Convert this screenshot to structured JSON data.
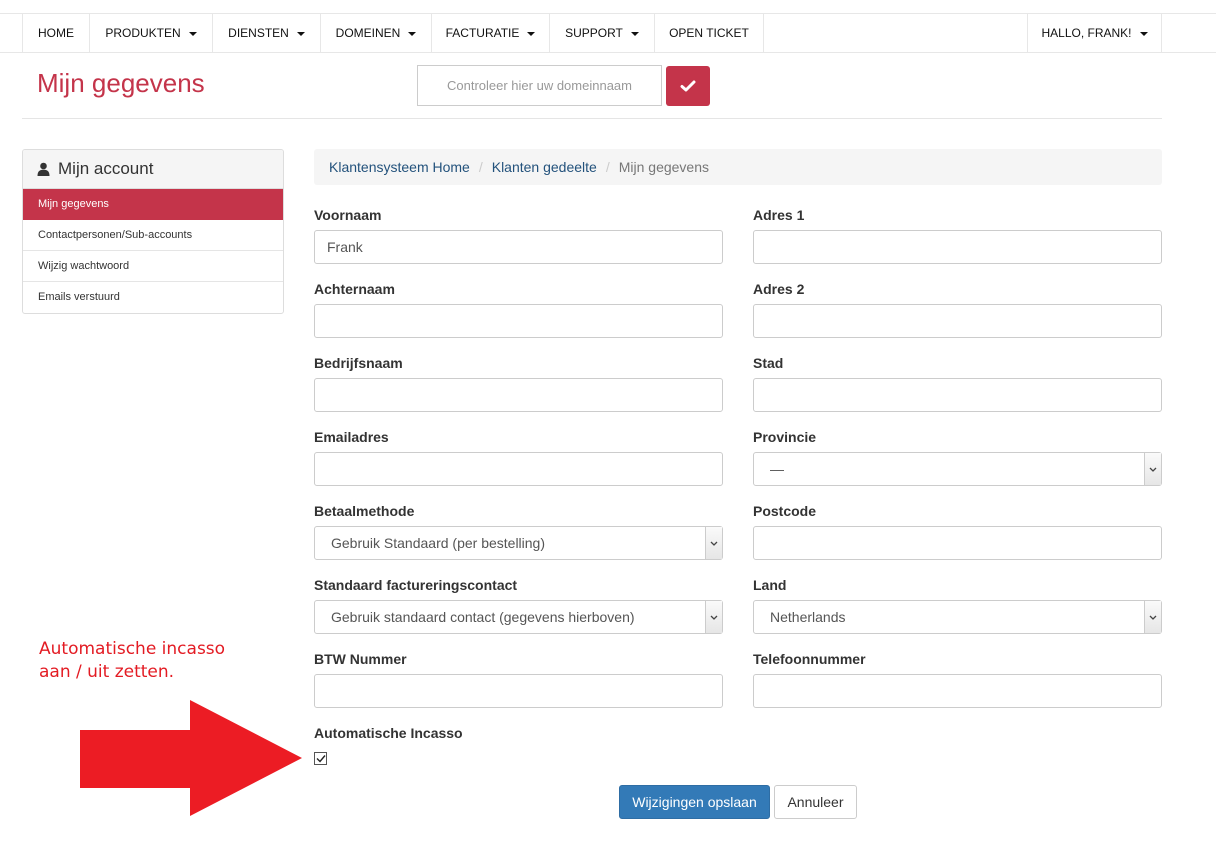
{
  "nav": {
    "home": "HOME",
    "produkten": "PRODUKTEN",
    "diensten": "DIENSTEN",
    "domeinen": "DOMEINEN",
    "facturatie": "FACTURATIE",
    "support": "SUPPORT",
    "open_ticket": "OPEN TICKET",
    "user": "HALLO, FRANK!"
  },
  "header": {
    "title": "Mijn gegevens",
    "domain_placeholder": "Controleer hier uw domeinnaam"
  },
  "sidebar": {
    "title": "Mijn account",
    "items": [
      "Mijn gegevens",
      "Contactpersonen/Sub-accounts",
      "Wijzig wachtwoord",
      "Emails verstuurd"
    ]
  },
  "breadcrumb": {
    "home": "Klantensysteem Home",
    "section": "Klanten gedeelte",
    "current": "Mijn gegevens"
  },
  "form": {
    "voornaam": {
      "label": "Voornaam",
      "value": "Frank"
    },
    "achternaam": {
      "label": "Achternaam",
      "value": ""
    },
    "bedrijfsnaam": {
      "label": "Bedrijfsnaam",
      "value": ""
    },
    "email": {
      "label": "Emailadres",
      "value": ""
    },
    "betaalmethode": {
      "label": "Betaalmethode",
      "value": "Gebruik Standaard (per bestelling)"
    },
    "factureringscontact": {
      "label": "Standaard factureringscontact",
      "value": "Gebruik standaard contact (gegevens hierboven)"
    },
    "btw": {
      "label": "BTW Nummer",
      "value": ""
    },
    "adres1": {
      "label": "Adres 1",
      "value": ""
    },
    "adres2": {
      "label": "Adres 2",
      "value": ""
    },
    "stad": {
      "label": "Stad",
      "value": ""
    },
    "provincie": {
      "label": "Provincie",
      "value": "—"
    },
    "postcode": {
      "label": "Postcode",
      "value": ""
    },
    "land": {
      "label": "Land",
      "value": "Netherlands"
    },
    "telefoon": {
      "label": "Telefoonnummer",
      "value": ""
    },
    "incasso": {
      "label": "Automatische Incasso",
      "checked": true
    }
  },
  "buttons": {
    "save": "Wijzigingen opslaan",
    "cancel": "Annuleer"
  },
  "annotation": {
    "line1": "Automatische incasso",
    "line2": "aan / uit zetten."
  },
  "colors": {
    "brand": "#c4344a",
    "primary": "#337ab7",
    "annotation": "#e31b23"
  }
}
